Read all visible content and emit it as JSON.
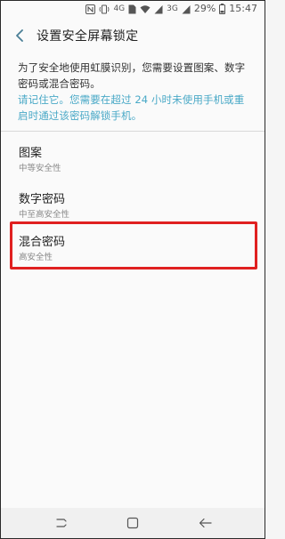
{
  "status_bar": {
    "icons": [
      "nfc-icon",
      "vibrate-icon",
      "4g-icon",
      "sim-1-icon",
      "wifi-icon",
      "signal-1-icon",
      "3g-icon",
      "signal-2-icon",
      "battery-icon"
    ],
    "net_4g": "4G",
    "net_3g": "3G",
    "sim_label": "1",
    "battery_percent": "29%",
    "time": "15:47"
  },
  "header": {
    "title": "设置安全屏幕锁定"
  },
  "description": "为了安全地使用虹膜识别，您需要设置图案、数字密码或混合密码。",
  "reminder": "请记住它。您需要在超过 24 小时未使用手机或重启时通过该密码解锁手机。",
  "options": [
    {
      "title": "图案",
      "subtitle": "中等安全性"
    },
    {
      "title": "数字密码",
      "subtitle": "中至高安全性"
    },
    {
      "title": "混合密码",
      "subtitle": "高安全性"
    }
  ],
  "nav_bar": {
    "buttons": [
      "recent-apps-icon",
      "home-icon",
      "back-icon"
    ]
  },
  "colors": {
    "accent": "#4aa9c7",
    "highlight": "#e02020",
    "text_primary": "#222222",
    "text_secondary": "#8a8a8a"
  }
}
